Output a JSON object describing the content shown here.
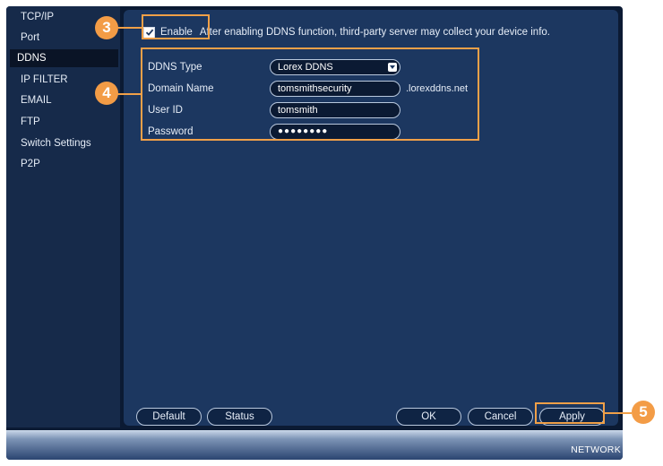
{
  "sidebar": {
    "items": [
      {
        "label": "TCP/IP",
        "active": false
      },
      {
        "label": "Port",
        "active": false
      },
      {
        "label": "DDNS",
        "active": true
      },
      {
        "label": "IP FILTER",
        "active": false
      },
      {
        "label": "EMAIL",
        "active": false
      },
      {
        "label": "FTP",
        "active": false
      },
      {
        "label": "Switch Settings",
        "active": false
      },
      {
        "label": "P2P",
        "active": false
      }
    ]
  },
  "enable": {
    "label": "Enable",
    "checked": true,
    "note": "After enabling DDNS function, third-party server may collect your device info."
  },
  "form": {
    "ddns_type_label": "DDNS Type",
    "ddns_type_value": "Lorex DDNS",
    "domain_name_label": "Domain Name",
    "domain_name_value": "tomsmithsecurity",
    "domain_suffix": ".lorexddns.net",
    "user_id_label": "User ID",
    "user_id_value": "tomsmith",
    "password_label": "Password",
    "password_value": "●●●●●●●●"
  },
  "buttons": {
    "default": "Default",
    "status": "Status",
    "ok": "OK",
    "cancel": "Cancel",
    "apply": "Apply"
  },
  "bottom_bar": {
    "caption": "NETWORK"
  },
  "callouts": {
    "step3": "3",
    "step4": "4",
    "step5": "5"
  },
  "colors": {
    "accent_orange": "#f39c46",
    "panel_bg": "#1c3760",
    "sidebar_bg": "#162a4a",
    "app_bg": "#0b1a33"
  }
}
